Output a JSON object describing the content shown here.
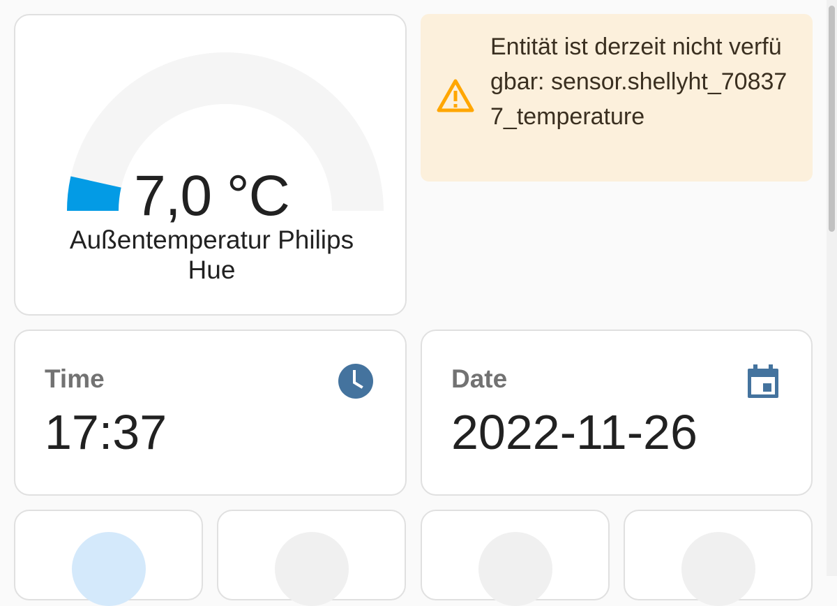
{
  "gauge": {
    "value_text": "7,0 °C",
    "name": "Außentemperatur Philips Hue",
    "value": 7.0,
    "min": 0,
    "max": 100,
    "fill_color": "#039be5",
    "track_color": "#f5f5f5"
  },
  "warning": {
    "text": "Entität ist derzeit nicht verfügbar: sensor.shellyht_708377_temperature",
    "icon": "alert-triangle-icon",
    "icon_color": "#ffa600"
  },
  "time_card": {
    "name": "Time",
    "value": "17:37",
    "icon": "clock-icon",
    "icon_color": "#44739e"
  },
  "date_card": {
    "name": "Date",
    "value": "2022-11-26",
    "icon": "calendar-icon",
    "icon_color": "#44739e"
  },
  "buttons": [
    {
      "state": "on"
    },
    {
      "state": "off"
    },
    {
      "state": "off"
    },
    {
      "state": "off"
    }
  ]
}
